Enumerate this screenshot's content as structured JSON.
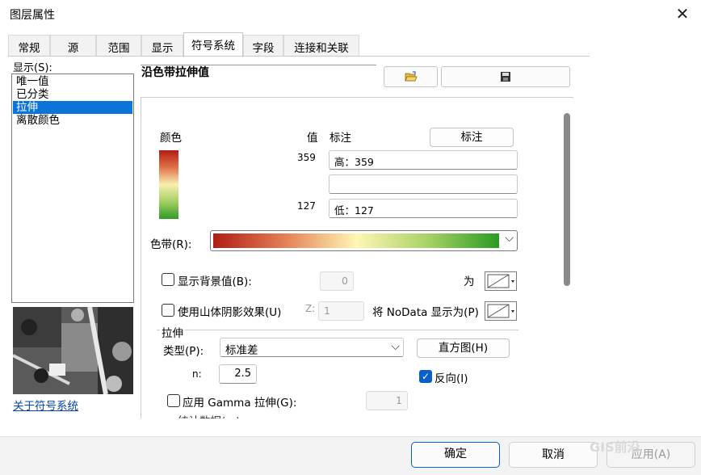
{
  "window": {
    "title": "图层属性",
    "close_glyph": "✕"
  },
  "tabs": [
    "常规",
    "源",
    "范围",
    "显示",
    "符号系统",
    "字段",
    "连接和关联"
  ],
  "active_tab": "符号系统",
  "left": {
    "show_label": "显示(S):",
    "items": [
      "唯一值",
      "已分类",
      "拉伸",
      "离散颜色"
    ],
    "selected": "拉伸",
    "about_link": "关于符号系统"
  },
  "header": {
    "title": "沿色带拉伸值",
    "open_icon": "folder-open-icon",
    "save_icon": "save-icon"
  },
  "legend": {
    "col_color": "颜色",
    "col_value": "值",
    "col_label": "标注",
    "label_button": "标注",
    "high_value": "359",
    "high_label": "高：359",
    "mid_label": "",
    "low_value": "127",
    "low_label": "低：127"
  },
  "ramp": {
    "label": "色带(R):",
    "colors": [
      "#b01e14",
      "#fff6b4",
      "#2a9b22"
    ]
  },
  "background": {
    "label": "显示背景值(B):",
    "value": "0",
    "as_label": "为",
    "checked": false
  },
  "hillshade": {
    "label": "使用山体阴影效果(U)",
    "z_label": "Z:",
    "z_value": "1",
    "nodata_label": "将 NoData 显示为(P)",
    "checked": false
  },
  "stretch": {
    "group_label": "拉伸",
    "type_label": "类型(P):",
    "type_value": "标准差",
    "histogram_button": "直方图(H)",
    "n_label": "n:",
    "n_value": "2.5",
    "invert_label": "反向(I)",
    "invert_checked": true,
    "gamma_label": "应用 Gamma 拉伸(G):",
    "gamma_value": "1",
    "gamma_checked": false,
    "stats_label": "统计数据(...)"
  },
  "footer": {
    "ok": "确定",
    "cancel": "取消",
    "apply": "应用(A)"
  },
  "watermark": "GIS前沿"
}
